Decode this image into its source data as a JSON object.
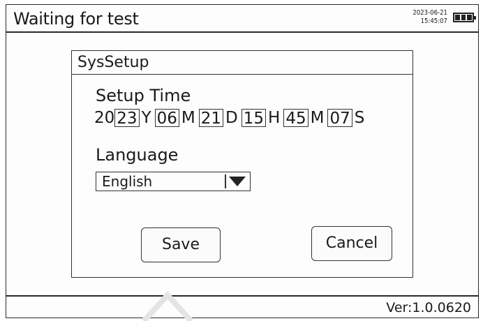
{
  "header": {
    "title": "Waiting for test",
    "date": "2023-06-21",
    "time": "15:45:07",
    "battery_icon": "battery-full-icon"
  },
  "dialog": {
    "title": "SysSetup",
    "setup_time_label": "Setup Time",
    "time": {
      "year_prefix": "20",
      "year": "23",
      "year_unit": "Y",
      "month": "06",
      "month_unit": "M",
      "day": "21",
      "day_unit": "D",
      "hour": "15",
      "hour_unit": "H",
      "minute": "45",
      "minute_unit": "M",
      "second": "07",
      "second_unit": "S"
    },
    "language_label": "Language",
    "language_value": "English",
    "save_label": "Save",
    "cancel_label": "Cancel"
  },
  "footer": {
    "version": "Ver:1.0.0620"
  },
  "colors": {
    "line": "#2a2a2a",
    "background": "#fdfdfd"
  }
}
